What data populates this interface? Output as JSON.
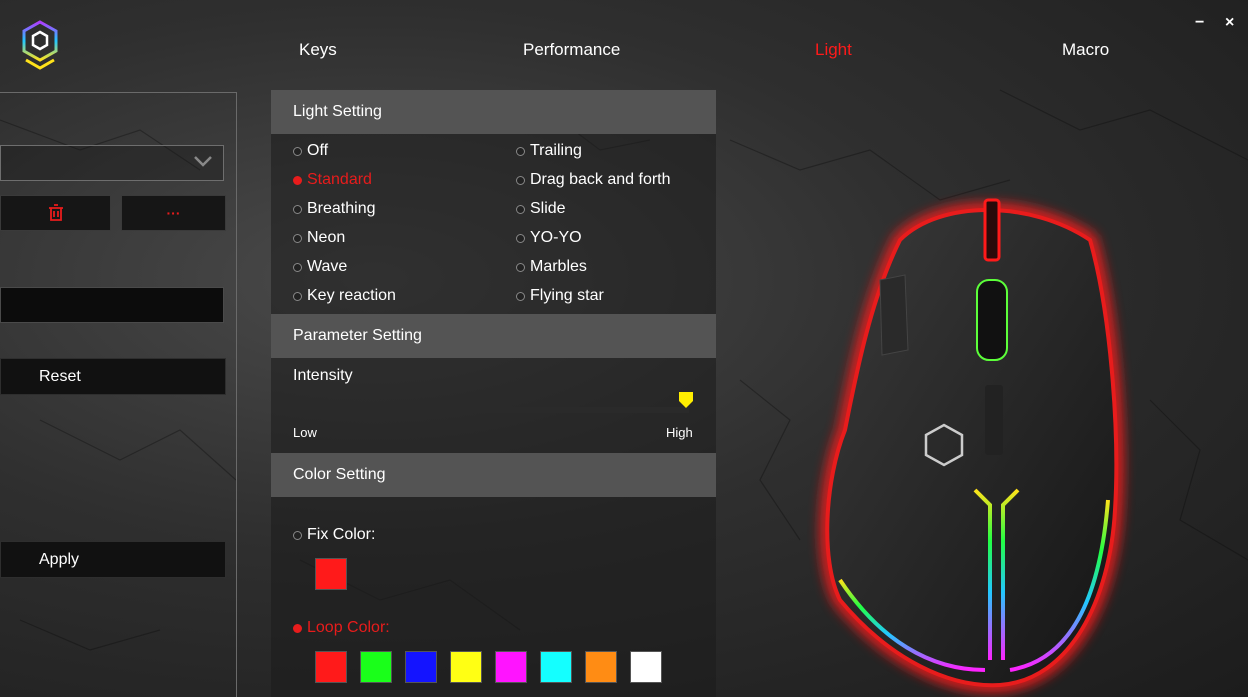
{
  "nav": {
    "tabs": [
      {
        "label": "Keys"
      },
      {
        "label": "Performance"
      },
      {
        "label": "Light",
        "active": true
      },
      {
        "label": "Macro"
      }
    ],
    "minimize": "−",
    "close": "×"
  },
  "left_panel": {
    "profile_value": "",
    "name_value": "",
    "more_label": "···",
    "reset_label": "Reset",
    "apply_label": "Apply"
  },
  "light_setting": {
    "title": "Light Setting",
    "modes_left": [
      "Off",
      "Standard",
      "Breathing",
      "Neon",
      "Wave",
      "Key reaction"
    ],
    "modes_right": [
      "Trailing",
      "Drag back and forth",
      "Slide",
      "YO-YO",
      "Marbles",
      "Flying star"
    ],
    "selected": "Standard"
  },
  "parameter_setting": {
    "title": "Parameter Setting",
    "intensity_label": "Intensity",
    "low_label": "Low",
    "high_label": "High",
    "intensity_value": 1.0
  },
  "color_setting": {
    "title": "Color Setting",
    "fix_color_label": "Fix Color:",
    "fix_color": "#ff1a1a",
    "loop_color_label": "Loop Color:",
    "loop_colors": [
      "#ff1a1a",
      "#1aff1a",
      "#1414ff",
      "#ffff14",
      "#ff14ff",
      "#14ffff",
      "#ff8c14",
      "#ffffff"
    ],
    "selected": "Loop Color"
  },
  "colors": {
    "accent": "#e81c1c",
    "section_header": "#545454"
  }
}
